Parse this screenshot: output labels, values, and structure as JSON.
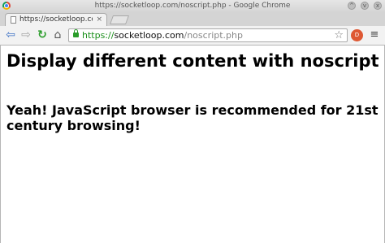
{
  "window": {
    "title": "https://socketloop.com/noscript.php - Google Chrome",
    "controls": [
      "^",
      "v",
      "x"
    ]
  },
  "tabs": [
    {
      "label": "https://socketloop.co",
      "close": "×"
    }
  ],
  "toolbar": {
    "back": "⇦",
    "forward": "⇨",
    "reload": "↻",
    "home": "⌂",
    "url_scheme": "https://",
    "url_host": "socketloop.com",
    "url_path": "/noscript.php",
    "star": "☆",
    "extension_label": "D",
    "menu": "≡"
  },
  "page": {
    "heading": "Display different content with noscript",
    "subheading": "Yeah! JavaScript browser is recommended for 21st century browsing!"
  },
  "colors": {
    "secure_green": "#1a8f1a",
    "reload_green": "#2a9d2a",
    "nav_blue": "#3a6fc4"
  }
}
